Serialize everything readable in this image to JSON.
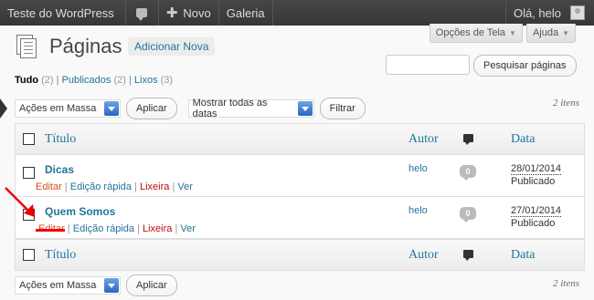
{
  "adminbar": {
    "site_name": "Teste do WordPress",
    "new_label": "Novo",
    "gallery_label": "Galeria",
    "howdy": "Olá, helo"
  },
  "screen_tabs": {
    "options_label": "Opções de Tela",
    "help_label": "Ajuda"
  },
  "page": {
    "title": "Páginas",
    "add_new_label": "Adicionar Nova"
  },
  "filters": {
    "all_label": "Tudo",
    "all_count": "(2)",
    "published_label": "Publicados",
    "published_count": "(2)",
    "trash_label": "Lixos",
    "trash_count": "(3)",
    "separator": "|"
  },
  "search": {
    "placeholder": "",
    "button_label": "Pesquisar páginas"
  },
  "tablenav_top": {
    "bulk_action": "Ações em Massa",
    "apply_label": "Aplicar",
    "dates_filter": "Mostrar todas as datas",
    "filter_label": "Filtrar",
    "items_count": "2 itens"
  },
  "tablenav_bottom": {
    "bulk_action": "Ações em Massa",
    "apply_label": "Aplicar",
    "items_count": "2 itens"
  },
  "table": {
    "columns": {
      "title": "Título",
      "author": "Autor",
      "date": "Data"
    },
    "rows": [
      {
        "title": "Dicas",
        "author": "helo",
        "comments": "0",
        "date": "28/01/2014",
        "status": "Publicado",
        "actions": {
          "edit": "Editar",
          "quick_edit": "Edição rápida",
          "trash": "Lixeira",
          "view": "Ver"
        }
      },
      {
        "title": "Quem Somos",
        "author": "helo",
        "comments": "0",
        "date": "27/01/2014",
        "status": "Publicado",
        "actions": {
          "edit": "Editar",
          "quick_edit": "Edição rápida",
          "trash": "Lixeira",
          "view": "Ver"
        }
      }
    ]
  },
  "colors": {
    "link": "#21759b",
    "edit": "#d54e21",
    "trash": "#bc0b0b",
    "annotation": "#e00000"
  }
}
